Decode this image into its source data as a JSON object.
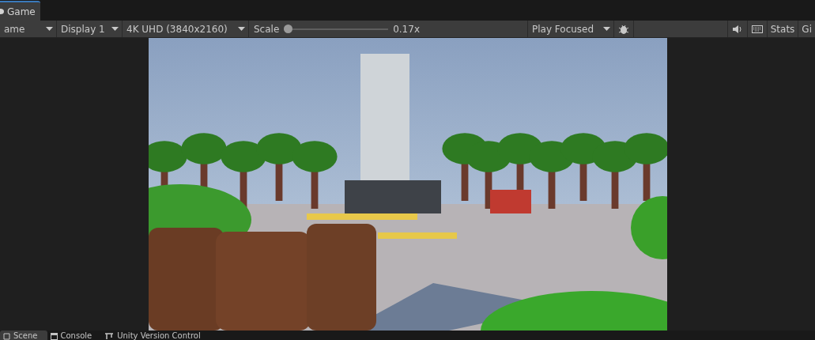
{
  "top_tabs": [
    {
      "label": "Game",
      "selected": true
    }
  ],
  "toolbar": {
    "dropdowns": [
      {
        "label": "ame"
      },
      {
        "label": "Display 1"
      },
      {
        "label": "4K UHD (3840x2160)"
      }
    ],
    "scale": {
      "label": "Scale",
      "level": 0.0,
      "reading": "0.17x"
    },
    "play_mode": {
      "label": "Play Focused"
    },
    "stats": "Stats",
    "gizmos": "Gi"
  },
  "bottom_tabs": [
    {
      "label": "Scene",
      "selected": true,
      "kind": "scene"
    },
    {
      "label": "Console",
      "selected": false,
      "kind": "console"
    },
    {
      "label": "Unity Version Control",
      "selected": false,
      "kind": "vcs"
    }
  ]
}
